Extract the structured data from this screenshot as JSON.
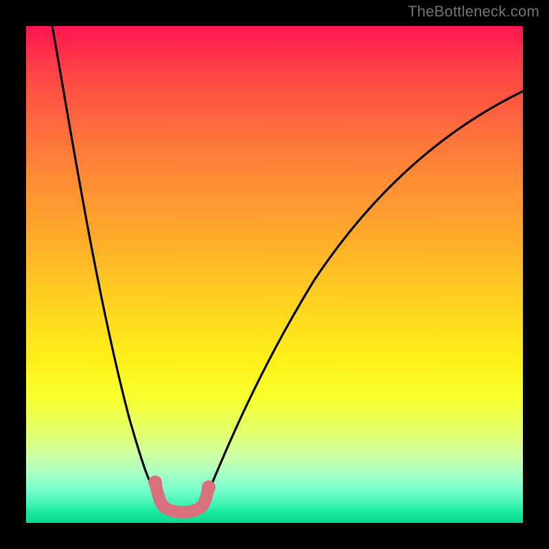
{
  "watermark": "TheBottleneck.com",
  "chart_data": {
    "type": "line",
    "title": "",
    "xlabel": "",
    "ylabel": "",
    "xlim": [
      0,
      100
    ],
    "ylim": [
      0,
      100
    ],
    "legend": false,
    "grid": false,
    "background_gradient": {
      "top": "#ff1452",
      "mid": "#fff21a",
      "bottom": "#09d98c"
    },
    "series": [
      {
        "name": "bottleneck-curve",
        "color": "#000000",
        "x": [
          5,
          10,
          15,
          20,
          24,
          26,
          28,
          30,
          32,
          34,
          36,
          38,
          42,
          50,
          60,
          72,
          86,
          100
        ],
        "y": [
          100,
          80,
          60,
          40,
          20,
          10,
          4,
          2,
          2,
          4,
          10,
          20,
          35,
          55,
          70,
          80,
          86,
          87
        ]
      },
      {
        "name": "optimal-segment",
        "color": "#d9717c",
        "x": [
          26,
          28,
          30,
          32,
          34,
          36
        ],
        "y": [
          8,
          4,
          2,
          2,
          4,
          7
        ]
      }
    ],
    "annotations": [
      {
        "text": "TheBottleneck.com",
        "position": "top-right",
        "color": "#737373"
      }
    ]
  }
}
